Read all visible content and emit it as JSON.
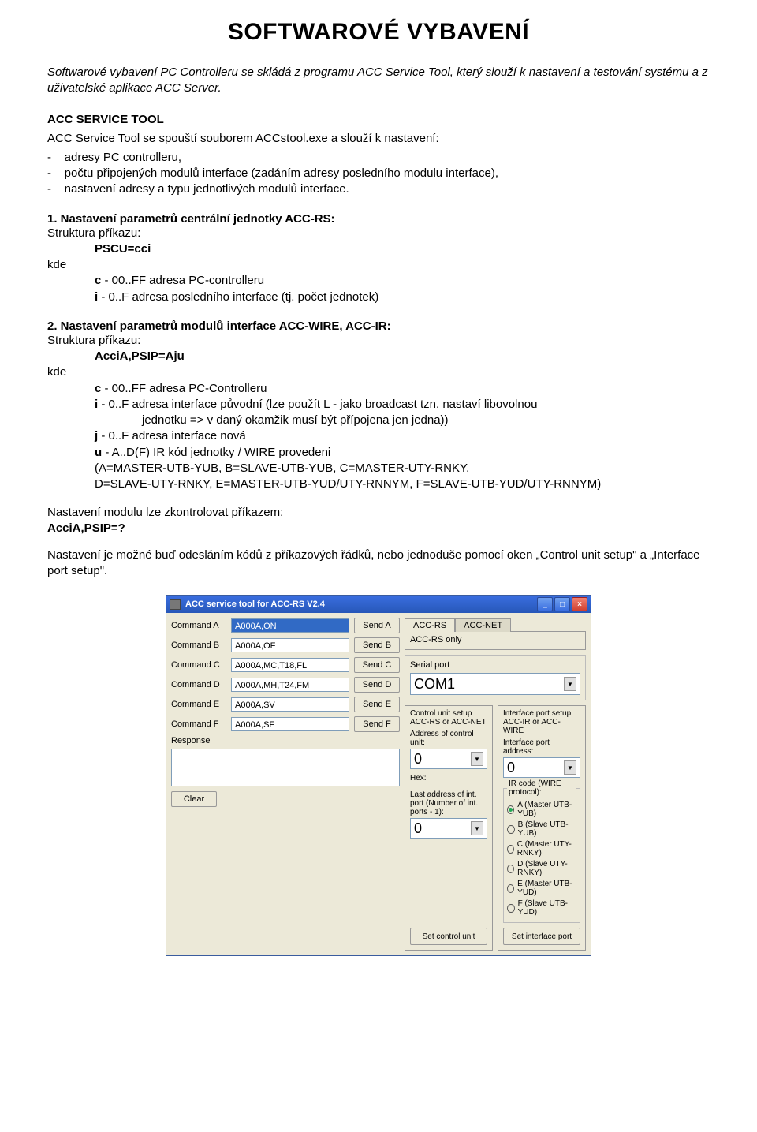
{
  "page": {
    "title": "SOFTWAROVÉ VYBAVENÍ",
    "intro": "Softwarové vybavení PC Controlleru se skládá z programu ACC Service Tool, který slouží k nastavení a testování systému a z uživatelské aplikace ACC Server.",
    "section1_heading": "ACC SERVICE TOOL",
    "section1_lead": "ACC Service Tool se spouští souborem ACCstool.exe a slouží k nastavení:",
    "bullets": [
      "adresy PC controlleru,",
      "počtu připojených modulů interface (zadáním adresy posledního modulu interface),",
      "nastavení adresy a typu jednotlivých modulů interface."
    ],
    "sub1_title": "1. Nastavení parametrů centrální jednotky ACC-RS:",
    "struct_label": "Struktura příkazu:",
    "kde": "kde",
    "sub1_cmd": "PSCU=cci",
    "sub1_defs": {
      "c_lbl": "c",
      "c_txt": " - 00..FF adresa PC-controlleru",
      "i_lbl": "i",
      "i_txt": " - 0..F adresa posledního interface (tj. počet jednotek)"
    },
    "sub2_title": "2. Nastavení parametrů modulů interface ACC-WIRE, ACC-IR:",
    "sub2_cmd": "AcciA,PSIP=Aju",
    "sub2_defs": {
      "c_lbl": "c",
      "c_txt": " - 00..FF adresa PC-Controlleru",
      "i_lbl": "i",
      "i_txt": " - 0..F adresa interface původní (lze použít L - jako broadcast tzn. nastaví libovolnou",
      "i_cont": "jednotku => v daný okamžik musí být přípojena jen jedna))",
      "j_lbl": "j",
      "j_txt": " - 0..F adresa interface nová",
      "u_lbl": "u",
      "u_txt": " - A..D(F) IR kód jednotky / WIRE provedeni",
      "u_extra1": "(A=MASTER-UTB-YUB, B=SLAVE-UTB-YUB, C=MASTER-UTY-RNKY,",
      "u_extra2": "D=SLAVE-UTY-RNKY, E=MASTER-UTB-YUD/UTY-RNNYM, F=SLAVE-UTB-YUD/UTY-RNNYM)"
    },
    "check_label": "Nastavení modulu lze zkontrolovat příkazem:",
    "check_cmd": "AcciA,PSIP=?",
    "closing": "Nastavení je možné buď odesláním kódů z příkazových řádků, nebo jednoduše pomocí oken „Control unit setup\" a „Interface port setup\"."
  },
  "app": {
    "title": "ACC service tool for ACC-RS   V2.4",
    "commands": [
      {
        "label": "Command A",
        "value": "A000A,ON",
        "btn": "Send A"
      },
      {
        "label": "Command B",
        "value": "A000A,OF",
        "btn": "Send B"
      },
      {
        "label": "Command C",
        "value": "A000A,MC,T18,FL",
        "btn": "Send C"
      },
      {
        "label": "Command D",
        "value": "A000A,MH,T24,FM",
        "btn": "Send D"
      },
      {
        "label": "Command E",
        "value": "A000A,SV",
        "btn": "Send E"
      },
      {
        "label": "Command F",
        "value": "A000A,SF",
        "btn": "Send F"
      }
    ],
    "response_label": "Response",
    "clear_label": "Clear",
    "tabs": [
      "ACC-RS",
      "ACC-NET"
    ],
    "tab_note": "ACC-RS only",
    "serial_group": "Serial port",
    "serial_value": "COM1",
    "hex_label": "Hex:",
    "left_group": {
      "title1": "Control unit setup",
      "title2": "ACC-RS or ACC-NET",
      "addr_label": "Address of control unit:",
      "addr_value": "0",
      "last_label": "Last address of int. port (Number of int. ports - 1):",
      "last_value": "0",
      "btn": "Set control unit"
    },
    "right_group": {
      "title1": "Interface port setup",
      "title2": "ACC-IR or ACC-WIRE",
      "addr_label": "Interface port address:",
      "addr_value": "0",
      "radios_legend": "IR code (WIRE protocol):",
      "radios": [
        "A (Master UTB-YUB)",
        "B (Slave UTB-YUB)",
        "C (Master UTY-RNKY)",
        "D (Slave UTY-RNKY)",
        "E (Master UTB-YUD)",
        "F (Slave UTB-YUD)"
      ],
      "btn": "Set interface port"
    }
  }
}
